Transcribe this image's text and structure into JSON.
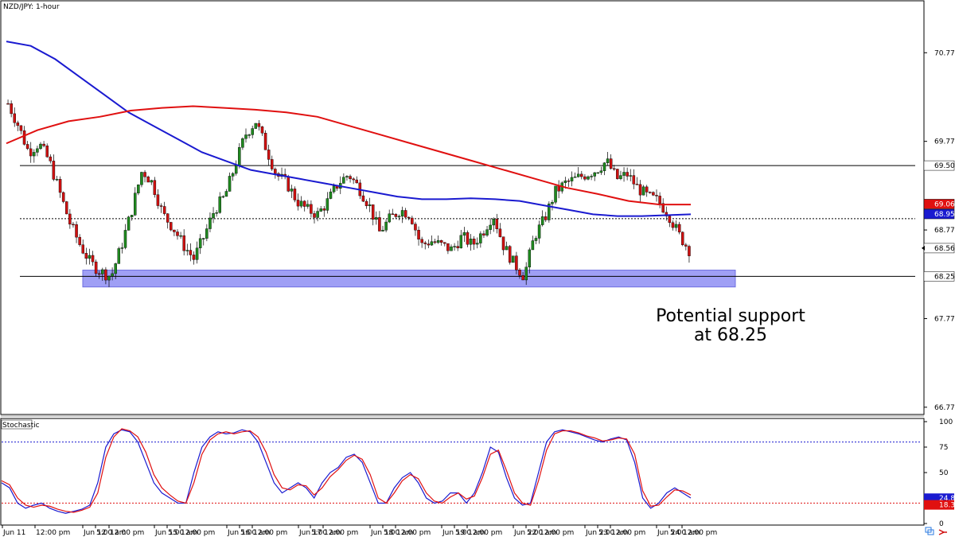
{
  "chart_data": [
    {
      "type": "candlestick",
      "title": "NZD/JPY: 1-hour",
      "ylim": [
        66.7,
        71.35
      ],
      "y_ticks": [
        "70.773",
        "69.773",
        "68.773",
        "67.773",
        "66.773"
      ],
      "y_tick_values": [
        70.773,
        69.773,
        68.773,
        67.773,
        66.773
      ],
      "x_ticks": [
        "Jun 11",
        "12:00 pm",
        "Jun 12",
        "5:00 am",
        "12:00 pm",
        "Jun 15",
        "5:00 am",
        "12:00 pm",
        "Jun 16",
        "5:00 am",
        "12:00 pm",
        "Jun 17",
        "5:00 am",
        "12:00 pm",
        "Jun 18",
        "5:00 am",
        "12:00 pm",
        "Jun 19",
        "5:00 am",
        "12:00 pm",
        "Jun 22",
        "5:00 am",
        "12:00 pm",
        "Jun 23",
        "5:00 am",
        "12:00 pm",
        "Jun 24",
        "5:00 am",
        "12:00 pm"
      ],
      "x_tick_overlap": "1:0__m",
      "series": [
        {
          "kind": "ohlc",
          "color_up": "#1f8a1f",
          "color_down": "#d01010",
          "close_path": [
            70.2,
            69.95,
            69.65,
            69.75,
            69.55,
            69.2,
            68.85,
            68.6,
            68.4,
            68.3,
            68.25,
            68.6,
            69.0,
            69.45,
            69.3,
            68.95,
            68.8,
            68.6,
            68.45,
            68.7,
            69.0,
            69.15,
            69.5,
            69.85,
            70.0,
            69.7,
            69.4,
            69.3,
            69.1,
            69.0,
            68.95,
            69.1,
            69.3,
            69.4,
            69.25,
            69.05,
            68.75,
            68.9,
            69.0,
            68.95,
            68.6,
            68.65,
            68.6,
            68.55,
            68.7,
            68.6,
            68.75,
            68.95,
            68.6,
            68.4,
            68.25,
            68.7,
            68.9,
            69.2,
            69.3,
            69.35,
            69.4,
            69.45,
            69.55,
            69.35,
            69.4,
            69.25,
            69.15,
            69.1,
            68.95,
            68.72,
            68.55
          ]
        },
        {
          "kind": "moving-average",
          "color": "#1a1ad0",
          "path": [
            70.9,
            70.85,
            70.7,
            70.5,
            70.3,
            70.1,
            69.95,
            69.8,
            69.65,
            69.55,
            69.45,
            69.4,
            69.35,
            69.3,
            69.25,
            69.2,
            69.15,
            69.12,
            69.12,
            69.13,
            69.12,
            69.1,
            69.05,
            69.0,
            68.95,
            68.93,
            68.93,
            68.94,
            68.95
          ],
          "last": "68.953"
        },
        {
          "kind": "moving-average",
          "color": "#e01010",
          "path": [
            69.75,
            69.9,
            70.0,
            70.05,
            70.12,
            70.15,
            70.17,
            70.15,
            70.13,
            70.1,
            70.05,
            69.95,
            69.85,
            69.75,
            69.65,
            69.55,
            69.45,
            69.35,
            69.25,
            69.18,
            69.1,
            69.06,
            69.06
          ],
          "last": "69.066"
        }
      ],
      "levels": [
        {
          "value": 69.5,
          "label": "69.500",
          "style": "solid"
        },
        {
          "value": 68.25,
          "label": "68.250",
          "style": "solid"
        },
        {
          "value": 68.9,
          "style": "dotted"
        }
      ],
      "support_zone": {
        "from": 68.13,
        "to": 68.32,
        "color": "#9f9ff5"
      },
      "price_tags": [
        {
          "value": 69.5,
          "label": "69.500",
          "bg": "#ffffff",
          "fg": "#000000"
        },
        {
          "value": 69.066,
          "label": "69.066",
          "bg": "#e01010",
          "fg": "#ffffff"
        },
        {
          "value": 68.953,
          "label": "68.953",
          "bg": "#1a1ad0",
          "fg": "#ffffff"
        },
        {
          "value": 68.568,
          "label": "68.568",
          "bg": "#ffffff",
          "fg": "#000000"
        },
        {
          "value": 68.25,
          "label": "68.250",
          "bg": "#ffffff",
          "fg": "#000000"
        }
      ],
      "annotation": [
        "Potential support",
        "at 68.25"
      ]
    },
    {
      "type": "line",
      "title": "Stochastic",
      "ylim": [
        0,
        100
      ],
      "y_ticks": [
        "100",
        "75",
        "50",
        "25",
        "0"
      ],
      "y_tick_values": [
        100,
        75,
        50,
        25,
        0
      ],
      "levels": [
        {
          "value": 80,
          "color": "#1a1ad0",
          "style": "dotted"
        },
        {
          "value": 20,
          "color": "#e01010",
          "style": "dotted"
        }
      ],
      "series": [
        {
          "color": "#1a1ad0",
          "values": [
            40,
            35,
            20,
            15,
            18,
            20,
            15,
            12,
            10,
            12,
            14,
            18,
            40,
            75,
            88,
            92,
            90,
            80,
            60,
            40,
            30,
            25,
            20,
            20,
            50,
            75,
            85,
            90,
            88,
            89,
            92,
            90,
            80,
            60,
            40,
            30,
            35,
            40,
            35,
            25,
            40,
            50,
            55,
            65,
            68,
            60,
            40,
            20,
            20,
            35,
            45,
            50,
            40,
            25,
            20,
            22,
            30,
            30,
            20,
            30,
            50,
            75,
            70,
            45,
            25,
            18,
            20,
            50,
            80,
            90,
            92,
            90,
            88,
            85,
            82,
            80,
            83,
            85,
            82,
            60,
            25,
            15,
            20,
            30,
            35,
            30,
            25
          ],
          "last": "24.83"
        },
        {
          "color": "#e01010",
          "values": [
            42,
            38,
            25,
            18,
            16,
            18,
            17,
            14,
            12,
            11,
            13,
            16,
            30,
            65,
            85,
            93,
            91,
            85,
            70,
            48,
            35,
            28,
            22,
            20,
            40,
            68,
            82,
            88,
            90,
            88,
            90,
            91,
            85,
            70,
            48,
            35,
            33,
            38,
            37,
            28,
            35,
            46,
            53,
            62,
            67,
            63,
            48,
            25,
            20,
            30,
            42,
            48,
            44,
            30,
            22,
            20,
            26,
            30,
            24,
            27,
            45,
            68,
            72,
            52,
            30,
            20,
            18,
            42,
            72,
            88,
            91,
            91,
            89,
            86,
            84,
            81,
            82,
            84,
            83,
            68,
            32,
            17,
            18,
            26,
            33,
            32,
            28
          ],
          "last": "18.30"
        }
      ],
      "value_tags": [
        {
          "value": 24.83,
          "label": "24.83",
          "bg": "#1a1ad0",
          "fg": "#ffffff"
        },
        {
          "value": 18.3,
          "label": "18.30",
          "bg": "#e01010",
          "fg": "#ffffff"
        }
      ]
    }
  ],
  "ui": {
    "mt4_icons": [
      "duplicate-icon",
      "arrow-right-icon"
    ]
  }
}
